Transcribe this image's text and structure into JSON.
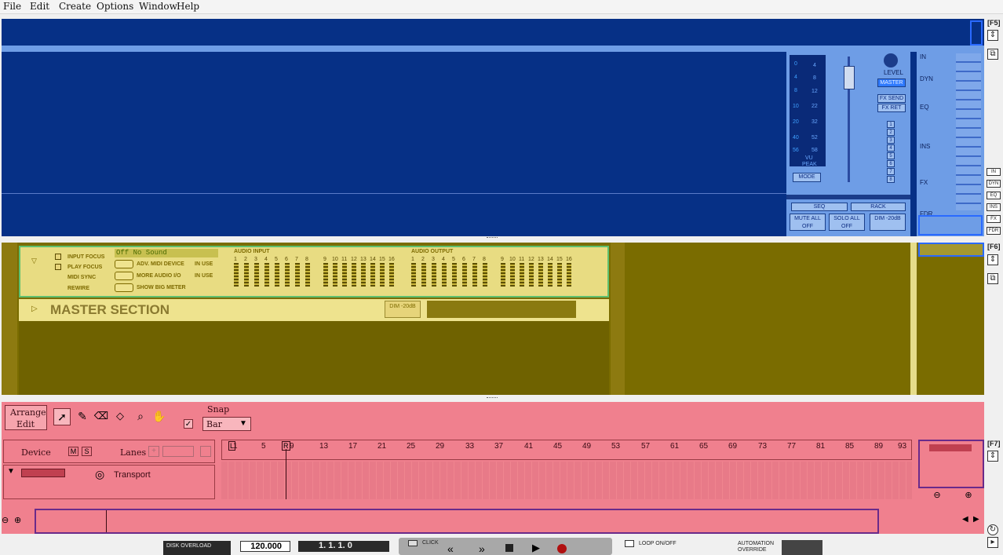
{
  "menu": [
    "File",
    "Edit",
    "Create",
    "Options",
    "Window",
    "Help"
  ],
  "side": {
    "f5": "[F5]",
    "f6": "[F6]",
    "f7": "[F7]",
    "strip_buttons": [
      "IN",
      "DYN",
      "EQ",
      "INS",
      "FX",
      "FDR"
    ]
  },
  "mixer": {
    "vu_left": [
      "0",
      "4",
      "8",
      "10",
      "20",
      "40",
      "56"
    ],
    "vu_right": [
      "4",
      "8",
      "12",
      "22",
      "32",
      "52",
      "58"
    ],
    "vu_label": "VU",
    "peak_label": "PEAK",
    "mode_label": "MODE",
    "level_label": "LEVEL",
    "master_label": "MASTER",
    "fx_send": "FX SEND",
    "fx_ret": "FX RET",
    "fx_numbers": [
      "1",
      "2",
      "3",
      "4",
      "5",
      "6",
      "7",
      "8"
    ],
    "seq_label": "SEQ",
    "rack_label": "RACK",
    "mute_all": "MUTE ALL OFF",
    "solo_all": "SOLO ALL OFF",
    "dim": "DIM -20dB",
    "strip_sections": [
      "IN",
      "DYN",
      "EQ",
      "INS",
      "FX",
      "FDR"
    ]
  },
  "rack": {
    "input_focus": "INPUT FOCUS",
    "play_focus": "PLAY FOCUS",
    "midi_sync": "MIDI SYNC",
    "rewire": "REWIRE",
    "sound_display": "Off  No Sound",
    "adv_midi": "ADV. MIDI DEVICE",
    "more_audio": "MORE AUDIO I/O",
    "show_big_meter": "SHOW BIG METER",
    "in_use": "IN USE",
    "audio_input": "AUDIO INPUT",
    "audio_output": "AUDIO OUTPUT",
    "channels": [
      "1",
      "2",
      "3",
      "4",
      "5",
      "6",
      "7",
      "8",
      "9",
      "10",
      "11",
      "12",
      "13",
      "14",
      "15",
      "16"
    ],
    "master_section": "MASTER SECTION",
    "master_dim": "DIM -20dB"
  },
  "sequencer": {
    "arrange": "Arrange",
    "edit": "Edit",
    "snap_label": "Snap",
    "snap_value": "Bar",
    "device_label": "Device",
    "m_btn": "M",
    "s_btn": "S",
    "lanes_label": "Lanes",
    "track_name": "Transport",
    "left_loc": "L",
    "right_loc": "R",
    "bar_numbers": [
      "1",
      "5",
      "9",
      "13",
      "17",
      "21",
      "25",
      "29",
      "33",
      "37",
      "41",
      "45",
      "49",
      "53",
      "57",
      "61",
      "65",
      "69",
      "73",
      "77",
      "81",
      "85",
      "89",
      "93"
    ]
  },
  "transport": {
    "disk_overload": "DISK OVERLOAD",
    "tempo": "120.000",
    "position": "1. 1. 1.   0",
    "click": "CLICK",
    "loop": "LOOP ON/OFF",
    "automation": "AUTOMATION OVERRIDE"
  },
  "colors": {
    "mixer_overlay": "#063086",
    "rack_overlay": "#7a6c00",
    "seq_overlay": "#f0808e"
  }
}
